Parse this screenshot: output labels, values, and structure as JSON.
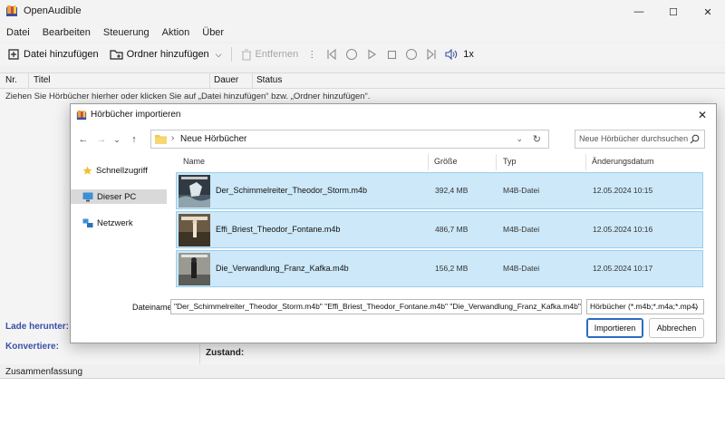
{
  "app": {
    "title": "OpenAudible",
    "window_controls": {
      "minimize": "—",
      "maximize": "☐",
      "close": "✕"
    }
  },
  "menu": [
    "Datei",
    "Bearbeiten",
    "Steuerung",
    "Aktion",
    "Über"
  ],
  "toolbar": {
    "add_file": "Datei hinzufügen",
    "add_folder": "Ordner hinzufügen",
    "remove": "Entfernen",
    "speed": "1x"
  },
  "table": {
    "columns": [
      "Nr.",
      "Titel",
      "Dauer",
      "Status"
    ],
    "hint": "Ziehen Sie Hörbücher hierher oder klicken Sie auf „Datei hinzufügen“ bzw. „Ordner hinzufügen“."
  },
  "lower": {
    "download_label": "Lade herunter:",
    "convert_label": "Konvertiere:",
    "state_label": "Zustand:",
    "summary_label": "Zusammenfassung"
  },
  "dialog": {
    "title": "Hörbücher importieren",
    "close": "✕",
    "address": "Neue Hörbücher",
    "search_placeholder": "Neue Hörbücher durchsuchen",
    "nav_items": [
      "Schnellzugriff",
      "Dieser PC",
      "Netzwerk"
    ],
    "columns": [
      "Name",
      "Größe",
      "Typ",
      "Änderungsdatum"
    ],
    "files": [
      {
        "name": "Der_Schimmelreiter_Theodor_Storm.m4b",
        "size": "392,4 MB",
        "type": "M4B-Datei",
        "date": "12.05.2024 10:15"
      },
      {
        "name": "Effi_Briest_Theodor_Fontane.m4b",
        "size": "486,7 MB",
        "type": "M4B-Datei",
        "date": "12.05.2024 10:16"
      },
      {
        "name": "Die_Verwandlung_Franz_Kafka.m4b",
        "size": "156,2 MB",
        "type": "M4B-Datei",
        "date": "12.05.2024 10:17"
      }
    ],
    "filename_label": "Dateiname:",
    "filename_value": "\"Der_Schimmelreiter_Theodor_Storm.m4b\" \"Effi_Briest_Theodor_Fontane.m4b\" \"Die_Verwandlung_Franz_Kafka.m4b\"",
    "filter_value": "Hörbücher (*.m4b;*.m4a;*.mp4)",
    "import_button": "Importieren",
    "cancel_button": "Abbrechen"
  },
  "colors": {
    "selection_fill": "#cde8f8",
    "selection_border": "#99cfec",
    "primary_button_border": "#2b6cc4",
    "label_blue": "#3a4fa8"
  }
}
